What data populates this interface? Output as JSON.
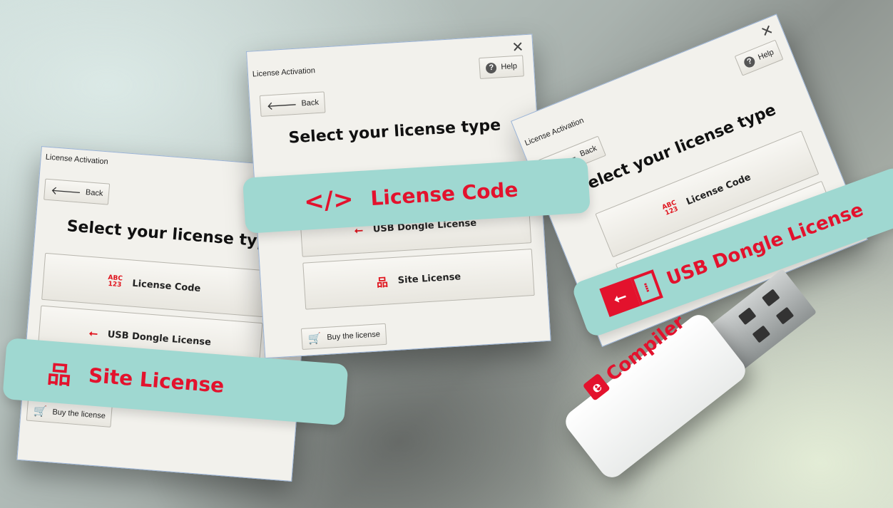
{
  "windows": [
    {
      "title": "License Activation",
      "back_label": "Back",
      "heading": "Select your license type",
      "options": [
        {
          "icon": "abc-123-icon",
          "label": "License Code"
        },
        {
          "icon": "usb-icon",
          "label": "USB Dongle License"
        }
      ],
      "buy_label": "Buy the license"
    },
    {
      "title": "License Activation",
      "close_glyph": "✕",
      "help_label": "Help",
      "back_label": "Back",
      "heading": "Select your license type",
      "options": [
        {
          "icon": "usb-icon",
          "label": "USB Dongle License"
        },
        {
          "icon": "site-network-icon",
          "label": "Site License"
        }
      ],
      "buy_label": "Buy the license"
    },
    {
      "title": "License Activation",
      "close_glyph": "✕",
      "help_label": "Help",
      "back_label": "Back",
      "heading": "Select your license type",
      "options": [
        {
          "icon": "abc-123-icon",
          "label": "License Code"
        },
        {
          "icon": "",
          "label": "Site License"
        }
      ]
    }
  ],
  "banners": {
    "site": {
      "label": "Site License",
      "icon": "site-network-icon"
    },
    "code": {
      "label": "License Code",
      "icon": "code-brackets-icon"
    },
    "usb": {
      "label": "USB Dongle License",
      "icon": "usb-icon"
    }
  },
  "usb_stick": {
    "brand_text": "Compiler",
    "logo_letter": "e"
  },
  "icon_text": {
    "abc_top": "ABC",
    "abc_bottom": "123"
  },
  "colors": {
    "accent_red": "#e3122d",
    "banner_teal": "#9fd8d1",
    "window_bg": "#f2f1ec"
  }
}
